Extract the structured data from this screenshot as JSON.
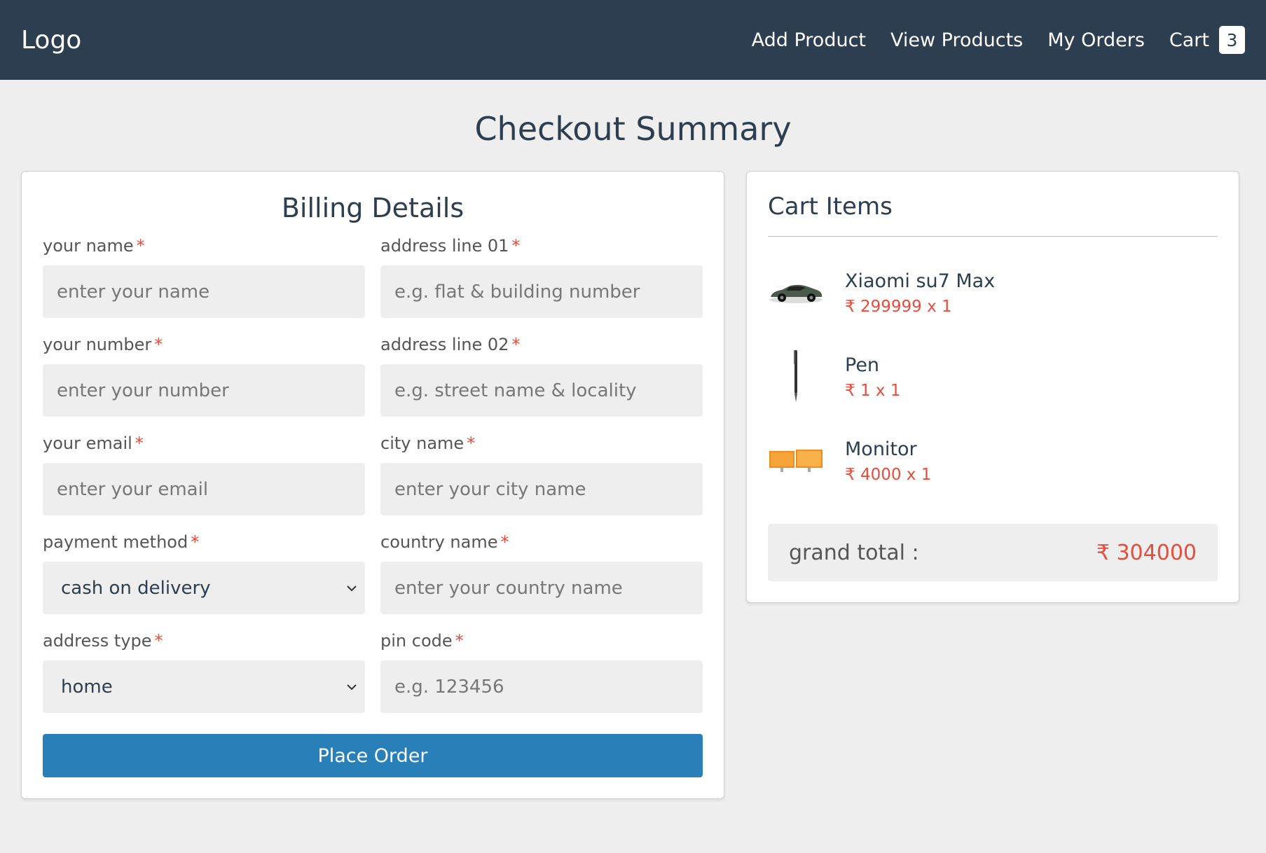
{
  "navbar": {
    "logo": "Logo",
    "links": [
      "Add Product",
      "View Products",
      "My Orders"
    ],
    "cart_label": "Cart",
    "cart_count": "3"
  },
  "page_title": "Checkout Summary",
  "billing": {
    "title": "Billing Details",
    "required_mark": "*",
    "fields": {
      "name": {
        "label": "your name",
        "placeholder": "enter your name"
      },
      "address1": {
        "label": "address line 01",
        "placeholder": "e.g. flat & building number"
      },
      "number": {
        "label": "your number",
        "placeholder": "enter your number"
      },
      "address2": {
        "label": "address line 02",
        "placeholder": "e.g. street name & locality"
      },
      "email": {
        "label": "your email",
        "placeholder": "enter your email"
      },
      "city": {
        "label": "city name",
        "placeholder": "enter your city name"
      },
      "payment": {
        "label": "payment method",
        "value": "cash on delivery"
      },
      "country": {
        "label": "country name",
        "placeholder": "enter your country name"
      },
      "address_type": {
        "label": "address type",
        "value": "home"
      },
      "pin": {
        "label": "pin code",
        "placeholder": "e.g. 123456"
      }
    },
    "submit_label": "Place Order"
  },
  "cart": {
    "title": "Cart Items",
    "currency": "₹",
    "items": [
      {
        "name": "Xiaomi su7 Max",
        "price": "299999 x 1",
        "image": "car-image"
      },
      {
        "name": "Pen",
        "price": "1 x 1",
        "image": "pen-image"
      },
      {
        "name": "Monitor",
        "price": "4000 x 1",
        "image": "monitor-image"
      }
    ],
    "grand_total_label": "grand total :",
    "grand_total_value": "304000"
  },
  "colors": {
    "navbar": "#2c3e50",
    "accent_button": "#2980b9",
    "price": "#e74c3c",
    "background": "#eeeeee"
  }
}
